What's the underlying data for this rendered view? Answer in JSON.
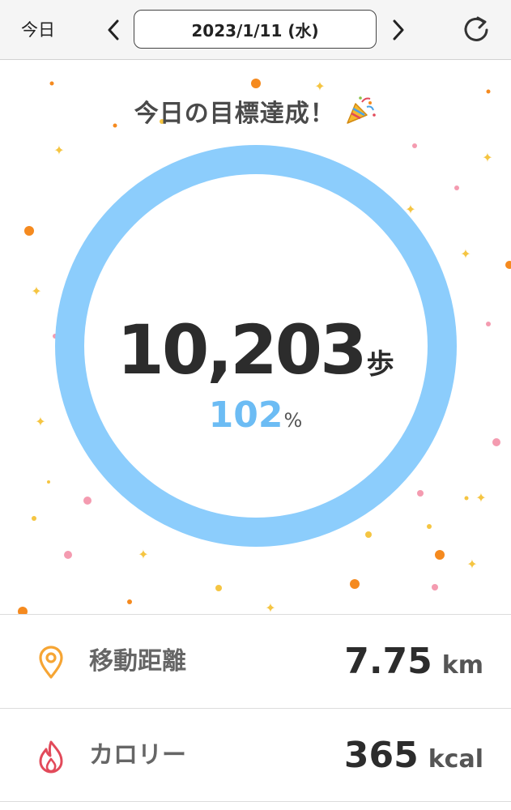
{
  "header": {
    "today_label": "今日",
    "date": "2023/1/11 (水)",
    "prev_icon": "chevron-left-icon",
    "next_icon": "chevron-right-icon",
    "refresh_icon": "refresh-icon"
  },
  "goal": {
    "title": "今日の目標達成！",
    "title_icon": "party-popper-icon",
    "steps": "10,203",
    "steps_unit": "歩",
    "percent": "102",
    "percent_unit": "%",
    "progress_fraction": 1.02,
    "ring_color": "#8ccdfc",
    "percent_color": "#6cbcf4"
  },
  "stats": {
    "distance": {
      "icon": "location-pin-icon",
      "label": "移動距離",
      "value": "7.75",
      "unit": "km",
      "icon_color": "#f6a534"
    },
    "calories": {
      "icon": "flame-icon",
      "label": "カロリー",
      "value": "365",
      "unit": "kcal",
      "icon_color": "#e24a5a"
    }
  },
  "colors": {
    "confetti_orange": "#f58a1f",
    "confetti_pink": "#f49bb0",
    "confetti_yellow": "#f5c542"
  }
}
